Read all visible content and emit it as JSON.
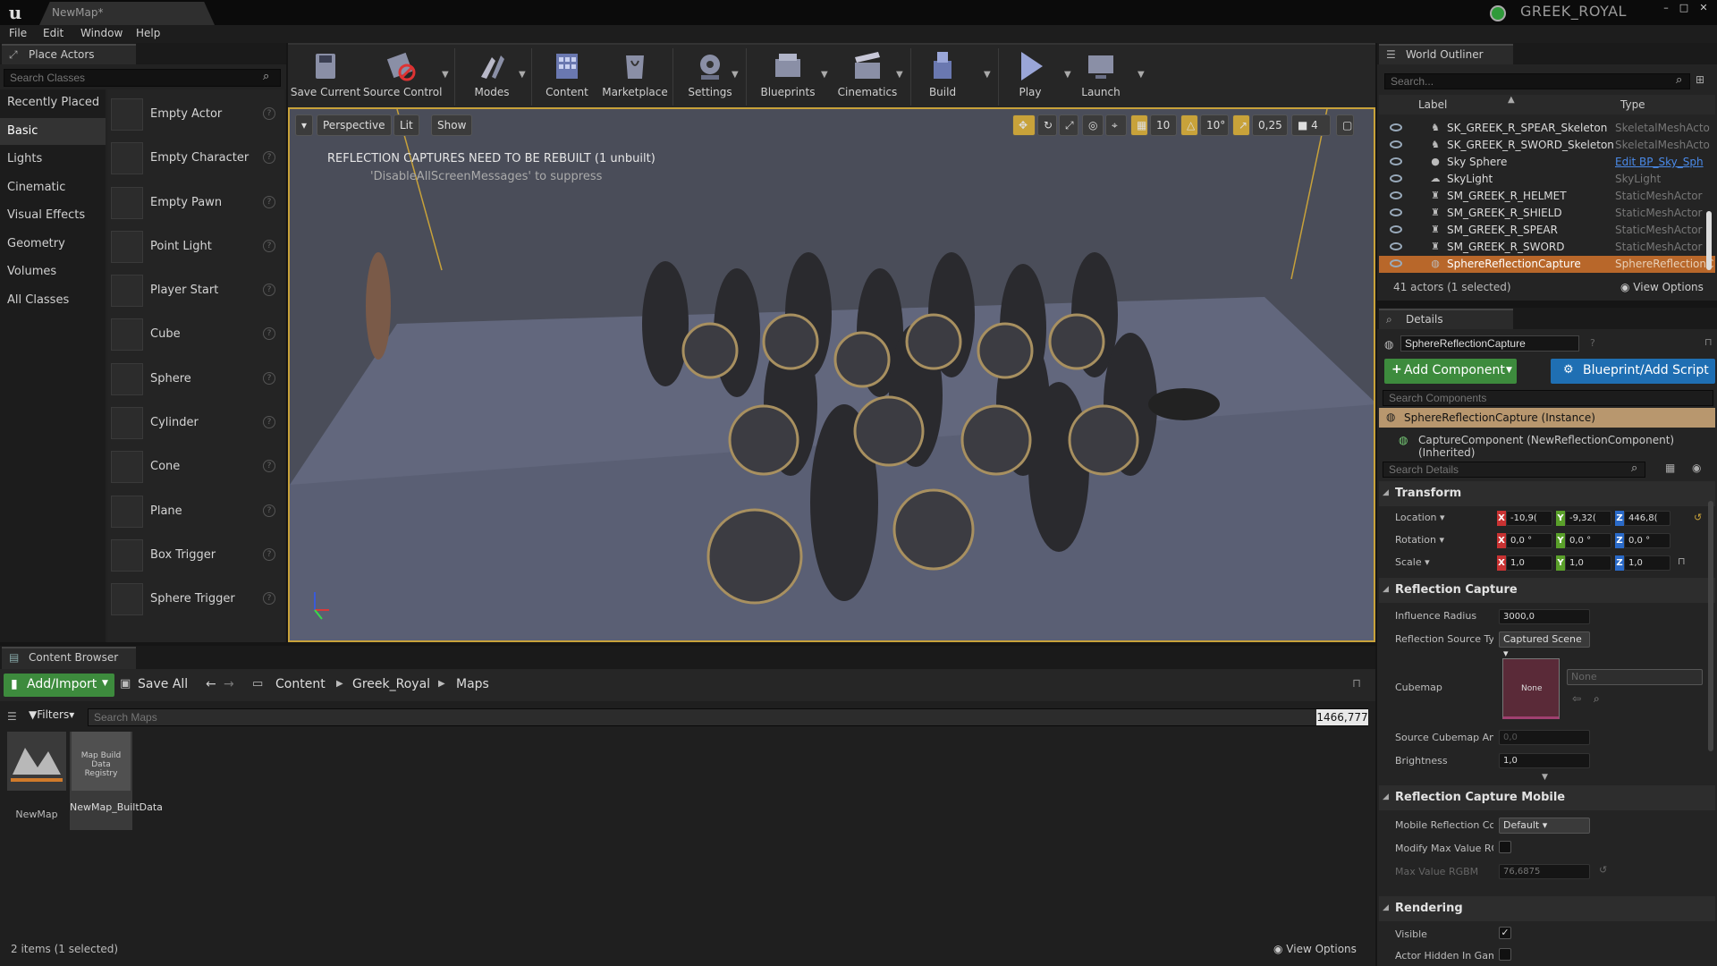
{
  "window": {
    "tab_title": "NewMap*",
    "project": "GREEK_ROYAL",
    "min": "–",
    "max": "□",
    "close": "✕"
  },
  "menu": [
    "File",
    "Edit",
    "Window",
    "Help"
  ],
  "place_actors": {
    "tab": "Place Actors",
    "search_placeholder": "Search Classes",
    "categories": [
      "Recently Placed",
      "Basic",
      "Lights",
      "Cinematic",
      "Visual Effects",
      "Geometry",
      "Volumes",
      "All Classes"
    ],
    "selected_category": "Basic",
    "items": [
      "Empty Actor",
      "Empty Character",
      "Empty Pawn",
      "Point Light",
      "Player Start",
      "Cube",
      "Sphere",
      "Cylinder",
      "Cone",
      "Plane",
      "Box Trigger",
      "Sphere Trigger"
    ]
  },
  "toolbar": {
    "buttons": [
      "Save Current",
      "Source Control",
      "Modes",
      "Content",
      "Marketplace",
      "Settings",
      "Blueprints",
      "Cinematics",
      "Build",
      "Play",
      "Launch"
    ]
  },
  "viewport": {
    "perspective": "Perspective",
    "lit": "Lit",
    "show": "Show",
    "grid": "10",
    "rotation": "10°",
    "scale": "0,25",
    "camera_speed": "4",
    "warning": "REFLECTION CAPTURES NEED TO BE REBUILT (1 unbuilt)",
    "warning_sub": "'DisableAllScreenMessages' to suppress"
  },
  "content_browser": {
    "tab": "Content Browser",
    "add_import": "Add/Import",
    "save_all": "Save All",
    "path": [
      "Content",
      "Greek_Royal",
      "Maps"
    ],
    "filters": "Filters",
    "search_placeholder": "Search Maps",
    "counter": "1466,777",
    "assets": [
      {
        "name": "NewMap",
        "thumb": ""
      },
      {
        "name": "NewMap_BuiltData",
        "thumb": "Map Build Data Registry"
      }
    ],
    "status": "2 items (1 selected)",
    "view_options": "View Options"
  },
  "outliner": {
    "tab": "World Outliner",
    "search_placeholder": "Search...",
    "col_label": "Label",
    "col_type": "Type",
    "rows": [
      {
        "name": "SK_GREEK_R_SPEAR_Skeleton",
        "type": "SkeletalMeshActo"
      },
      {
        "name": "SK_GREEK_R_SWORD_Skeleton",
        "type": "SkeletalMeshActo"
      },
      {
        "name": "Sky Sphere",
        "type": "Edit BP_Sky_Sph"
      },
      {
        "name": "SkyLight",
        "type": "SkyLight"
      },
      {
        "name": "SM_GREEK_R_HELMET",
        "type": "StaticMeshActor"
      },
      {
        "name": "SM_GREEK_R_SHIELD",
        "type": "StaticMeshActor"
      },
      {
        "name": "SM_GREEK_R_SPEAR",
        "type": "StaticMeshActor"
      },
      {
        "name": "SM_GREEK_R_SWORD",
        "type": "StaticMeshActor"
      },
      {
        "name": "SphereReflectionCapture",
        "type": "SphereReflectionC"
      }
    ],
    "count": "41 actors (1 selected)",
    "view_options": "View Options"
  },
  "details": {
    "tab": "Details",
    "name_value": "SphereReflectionCapture",
    "add_component": "Add Component",
    "blueprint": "Blueprint/Add Script",
    "search_components": "Search Components",
    "instance": "SphereReflectionCapture (Instance)",
    "component": "CaptureComponent (NewReflectionComponent) (Inherited)",
    "search_details": "Search Details",
    "transform": "Transform",
    "location": "Location",
    "rotation": "Rotation",
    "scale": "Scale",
    "loc": [
      "-10,9(",
      "-9,32(",
      "446,8("
    ],
    "rot": [
      "0,0 °",
      "0,0 °",
      "0,0 °"
    ],
    "scl": [
      "1,0",
      "1,0",
      "1,0"
    ],
    "reflection_capture": "Reflection Capture",
    "influence_radius": "Influence Radius",
    "influence_value": "3000,0",
    "source_type": "Reflection Source Typ",
    "source_value": "Captured Scene",
    "cubemap": "Cubemap",
    "cubemap_none": "None",
    "cubemap_drop": "None",
    "source_angle": "Source Cubemap Angl",
    "source_angle_value": "0,0",
    "brightness": "Brightness",
    "brightness_value": "1,0",
    "mobile": "Reflection Capture Mobile",
    "mobile_comp": "Mobile Reflection Con",
    "mobile_value": "Default",
    "modify_max": "Modify Max Value RGI",
    "max_value": "Max Value RGBM",
    "max_value_value": "76,6875",
    "rendering": "Rendering",
    "visible": "Visible",
    "hidden": "Actor Hidden In Game"
  },
  "colors": {
    "accent": "#c8a23a",
    "green": "#3d8b3d",
    "blue": "#1f6fb3",
    "orange_sel": "#b8672a"
  }
}
